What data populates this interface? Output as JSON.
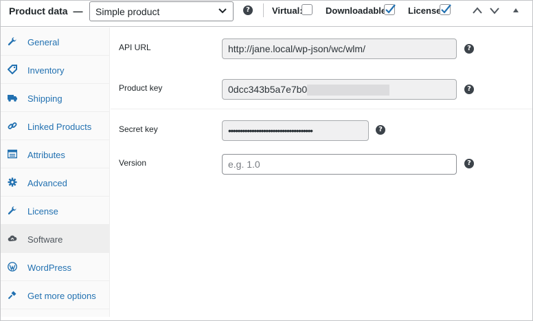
{
  "header": {
    "title": "Product data",
    "dash": "—",
    "product_type": "Simple product",
    "options": [
      {
        "label": "Virtual:",
        "checked": false
      },
      {
        "label": "Downloadable:",
        "checked": true
      },
      {
        "label": "License:",
        "checked": true
      }
    ],
    "help_glyph": "?"
  },
  "sidebar": {
    "items": [
      {
        "label": "General",
        "icon": "wrench-icon",
        "active": false
      },
      {
        "label": "Inventory",
        "icon": "tag-icon",
        "active": false
      },
      {
        "label": "Shipping",
        "icon": "truck-icon",
        "active": false
      },
      {
        "label": "Linked Products",
        "icon": "link-icon",
        "active": false
      },
      {
        "label": "Attributes",
        "icon": "table-icon",
        "active": false
      },
      {
        "label": "Advanced",
        "icon": "gear-icon",
        "active": false
      },
      {
        "label": "License",
        "icon": "wrench-icon",
        "active": false
      },
      {
        "label": "Software",
        "icon": "cloud-icon",
        "active": true
      },
      {
        "label": "WordPress",
        "icon": "wordpress-icon",
        "active": false
      },
      {
        "label": "Get more options",
        "icon": "plugin-icon",
        "active": false
      }
    ]
  },
  "fields": {
    "api_url": {
      "label": "API URL",
      "value": "http://jane.local/wp-json/wc/wlm/"
    },
    "product_key": {
      "label": "Product key",
      "value": "0dcc343b5a7e7b0"
    },
    "secret_key": {
      "label": "Secret key",
      "value": "••••••••••••••••••••••••••••••••••••"
    },
    "version": {
      "label": "Version",
      "placeholder": "e.g. 1.0"
    }
  },
  "colors": {
    "link": "#2271b1",
    "border": "#c3c4c7",
    "checkbox_check": "#2271b1"
  }
}
